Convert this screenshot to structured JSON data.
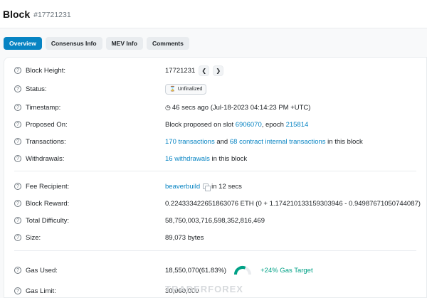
{
  "header": {
    "title": "Block",
    "subtitle": "#17721231"
  },
  "tabs": [
    {
      "label": "Overview",
      "active": true
    },
    {
      "label": "Consensus Info"
    },
    {
      "label": "MEV Info"
    },
    {
      "label": "Comments"
    }
  ],
  "rows": {
    "block_height": {
      "label": "Block Height:",
      "value": "17721231",
      "prev_icon": "chevron-left",
      "next_icon": "chevron-right"
    },
    "status": {
      "label": "Status:",
      "badge": "Unfinalized",
      "badge_icon": "hourglass"
    },
    "timestamp": {
      "label": "Timestamp:",
      "value": "46 secs ago (Jul-18-2023 04:14:23 PM +UTC)"
    },
    "proposed_on": {
      "label": "Proposed On:",
      "prefix": "Block proposed on slot ",
      "slot": "6906070",
      "middle": ", epoch ",
      "epoch": "215814"
    },
    "transactions": {
      "label": "Transactions:",
      "tx_link": "170 transactions",
      "middle": " and ",
      "internal_link": "68 contract internal transactions",
      "suffix": " in this block"
    },
    "withdrawals": {
      "label": "Withdrawals:",
      "link": "16 withdrawals",
      "suffix": " in this block"
    },
    "fee_recipient": {
      "label": "Fee Recipient:",
      "link": "beaverbuild",
      "suffix": "in 12 secs"
    },
    "block_reward": {
      "label": "Block Reward:",
      "value": "0.224333422651863076 ETH (0 + 1.174210133159303946 - 0.94987671050744087)"
    },
    "total_difficulty": {
      "label": "Total Difficulty:",
      "value": "58,750,003,716,598,352,816,469"
    },
    "size": {
      "label": "Size:",
      "value": "89,073 bytes"
    },
    "gas_used": {
      "label": "Gas Used:",
      "value": "18,550,070",
      "percent_text": "(61.83%)",
      "gauge_fraction": 0.6183,
      "target": "+24% Gas Target"
    },
    "gas_limit": {
      "label": "Gas Limit:",
      "value": "30,000,000"
    }
  },
  "watermark": "TRADERFOREX",
  "colors": {
    "accent": "#0784c3",
    "green": "#00a186",
    "gauge_track": "#e9ecef"
  }
}
